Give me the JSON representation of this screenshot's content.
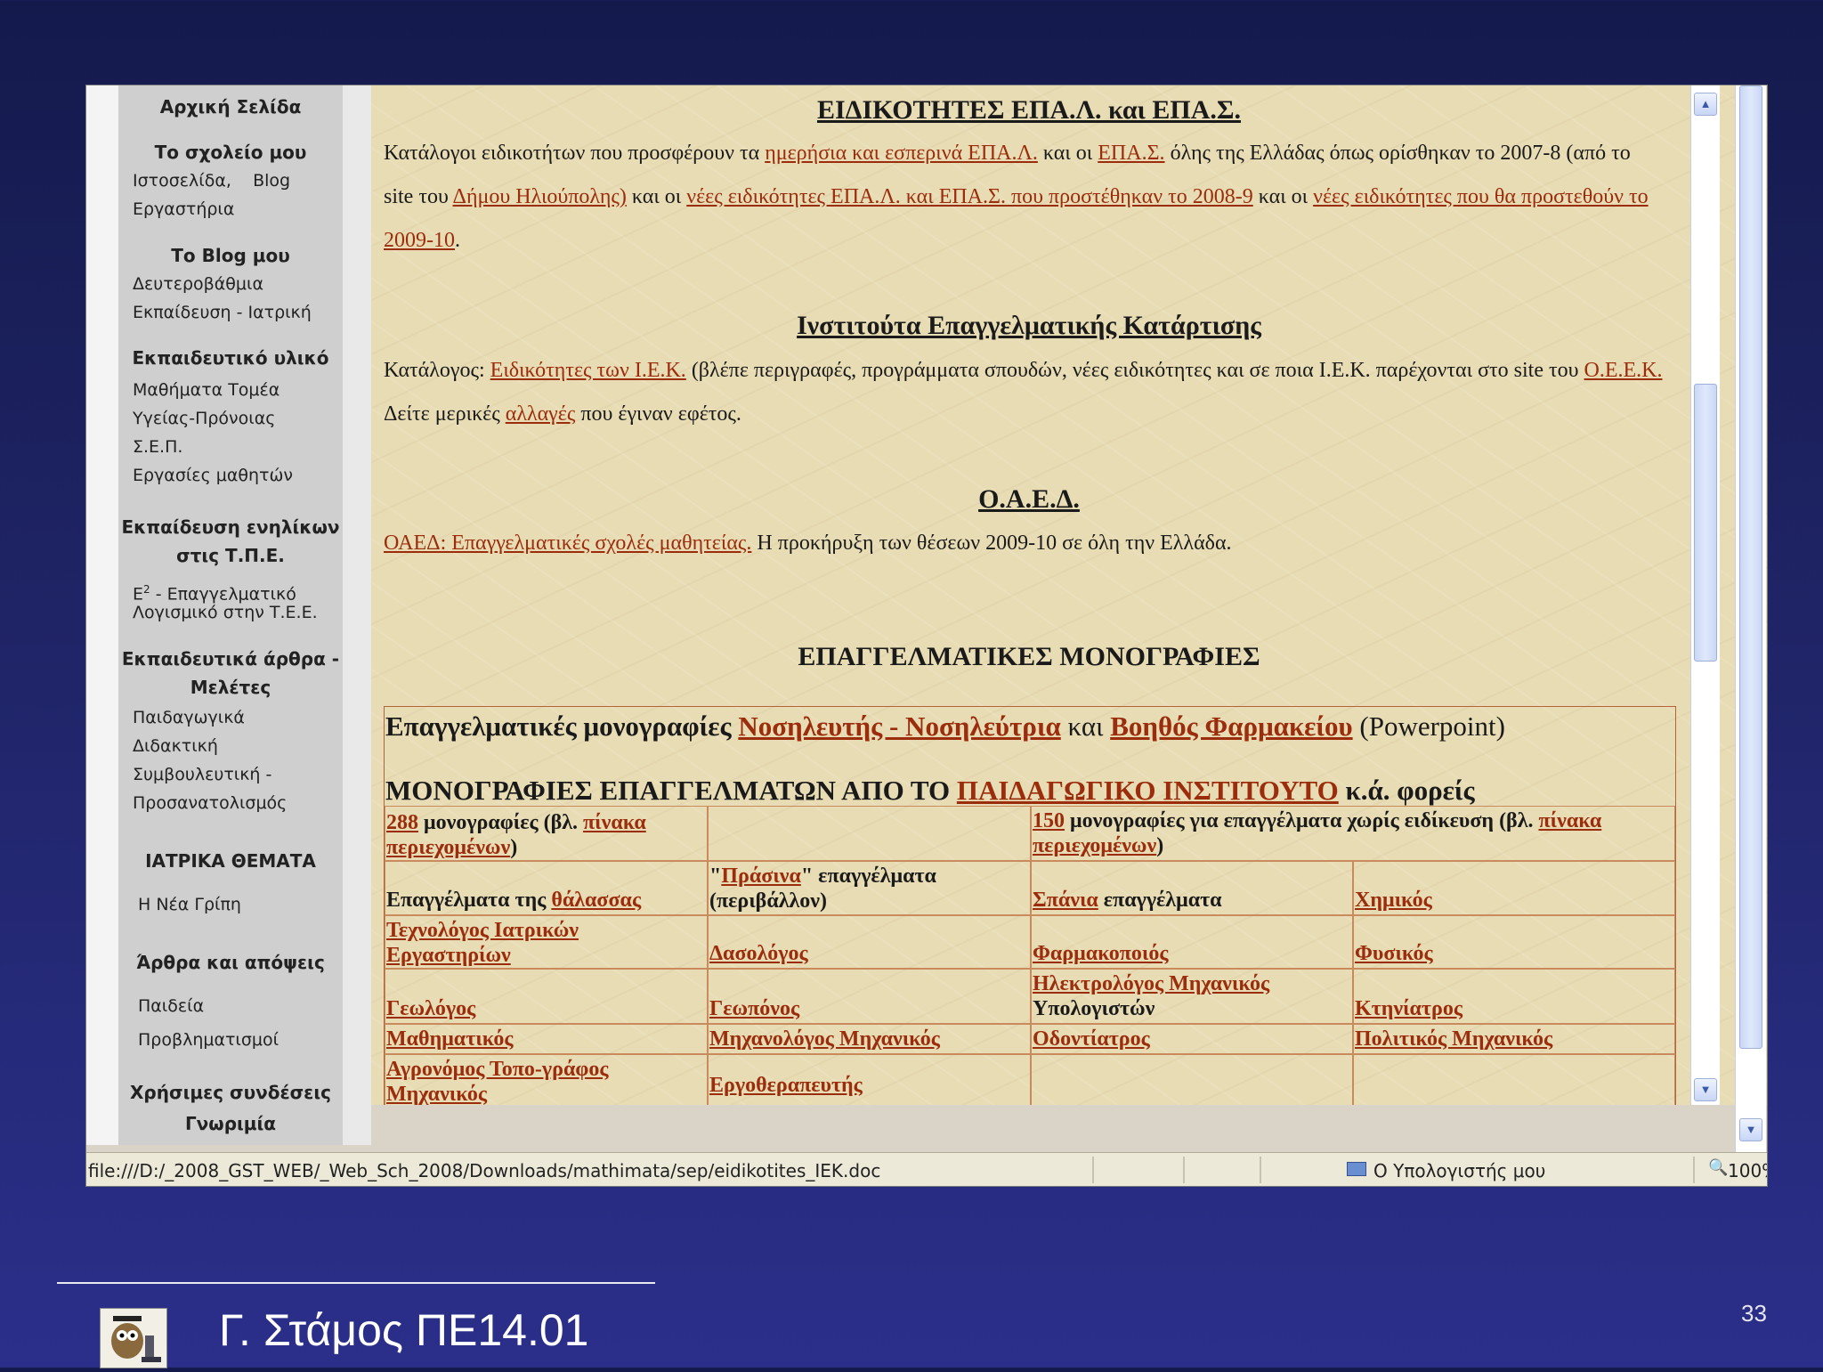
{
  "sidebar": {
    "home": "Αρχική  Σελίδα",
    "school_head": "Το σχολείο μου",
    "school_links": [
      "Ιστοσελίδα,",
      "Blog"
    ],
    "workshops": "Εργαστήρια",
    "blog_head": "Το Blog  μου",
    "blog_item1": "Δευτεροβάθμια",
    "blog_item2": "Εκπαίδευση - Ιατρική",
    "material_head": "Εκπαιδευτικό υλικό",
    "material_items": [
      "Μαθήματα Τομέα",
      "Υγείας-Πρόνοιας",
      "Σ.Ε.Π.",
      "Εργασίες μαθητών"
    ],
    "adult_head1": "Εκπαίδευση ενηλίκων",
    "adult_head2": "στις Τ.Π.Ε.",
    "adult_item1_pre": "Ε",
    "adult_item1_sup": "2",
    "adult_item1_post": " - Επαγγελματικό",
    "adult_item2": "Λογισμικό στην Τ.Ε.Ε.",
    "articles_head1": "Εκπαιδευτικά άρθρα -",
    "articles_head2": "Μελέτες",
    "articles_items": [
      "Παιδαγωγικά",
      "Διδακτική",
      "Συμβουλευτική -",
      "Προσανατολισμός"
    ],
    "medical_head": "ΙΑΤΡΙΚΑ ΘΕΜΑΤΑ",
    "medical_item": "Η Νέα Γρίπη",
    "opinions_head": "Άρθρα και απόψεις",
    "opinions_items": [
      "Παιδεία",
      "Προβληματισμοί"
    ],
    "useful_head": "Χρήσιμες συνδέσεις",
    "useful_item": "Γνωριμία"
  },
  "content": {
    "epal_title": "ΕΙΔΙΚΟΤΗΤΕΣ  ΕΠΑ.Λ. και ΕΠΑ.Σ.",
    "epal_p": {
      "t1": "Κατάλογοι ειδικοτήτων που προσφέρουν τα ",
      "l1": "ημερήσια και εσπερινά ΕΠΑ.Λ.",
      "t2": " και οι ",
      "l2": "ΕΠΑ.Σ.",
      "t3": " όλης της Ελλάδας όπως ορίσθηκαν το 2007-8 (από το site του ",
      "l3": "Δήμου Ηλιούπολης)",
      "t4": " και οι ",
      "l4": "νέες ειδικότητες ΕΠΑ.Λ. και ΕΠΑ.Σ. που προστέθηκαν το 2008-9",
      "t5": " και οι ",
      "l5": "νέες ειδικότητες που θα προστεθούν το 2009-10",
      "t6": "."
    },
    "iek_title": "Ινστιτούτα Επαγγελματικής Κατάρτισης",
    "iek_p": {
      "t1": "Κατάλογος: ",
      "l1": "Ειδικότητες των Ι.Ε.Κ.",
      "t2": " (βλέπε περιγραφές, προγράμματα σπουδών, νέες ειδικότητες και σε ποια Ι.Ε.Κ. παρέχονται στο site του ",
      "l2": "Ο.Ε.Ε.Κ.",
      "t3": " Δείτε μερικές ",
      "l3": "αλλαγές",
      "t4": " που έγιναν εφέτος."
    },
    "oaed_title": "Ο.Α.Ε.Δ.",
    "oaed_p": {
      "l1": "ΟΑΕΔ: Επαγγελματικές σχολές μαθητείας.",
      "t1": " Η προκήρυξη των θέσεων 2009-10 σε όλη την Ελλάδα."
    },
    "mono_title": "ΕΠΑΓΓΕΛΜΑΤΙΚΕΣ  ΜΟΝΟΓΡΑΦΙΕΣ",
    "mono_row1": {
      "t1": "Επαγγελματικές μονογραφίες ",
      "l1": "Νοσηλευτής - Νοσηλεύτρια",
      "t2": " και ",
      "l2": "Βοηθός Φαρμακείου",
      "t3": " (Powerpoint)"
    },
    "mono_row2": {
      "t1": "ΜΟΝΟΓΡΑΦΙΕΣ ΕΠΑΓΓΕΛΜΑΤΩΝ ΑΠΟ ΤΟ ",
      "l1": "ΠΑΙΔΑΓΩΓΙΚΟ ΙΝΣΤΙΤΟΥΤΟ",
      "t2": " κ.ά. φορείς"
    },
    "count_left": {
      "l1": "288",
      "t1": " μονογραφίες (βλ. ",
      "l2": "πίνακα περιεχομένων",
      "t2": ")"
    },
    "count_right": {
      "l1": "150",
      "t1": " μονογραφίες  για επαγγέλματα χωρίς ειδίκευση (βλ. ",
      "l2": "πίνακα περιεχομένων",
      "t2": ")"
    },
    "grid": {
      "r1c1_t": "Επαγγέλματα της ",
      "r1c1_l": "θάλασσας",
      "r1c2_q1": "\"",
      "r1c2_l": "Πράσινα",
      "r1c2_t": "\" επαγγέλματα (περιβάλλον)",
      "r1c3_l": "Σπάνια",
      "r1c3_t": " επαγγέλματα",
      "r1c4": "Χημικός",
      "r2c1": "Τεχνολόγος Ιατρικών Εργαστηρίων",
      "r2c2": "Δασολόγος",
      "r2c3": "Φαρμακοποιός",
      "r2c4": "Φυσικός",
      "r3c1": "Γεωλόγος",
      "r3c2": "Γεωπόνος",
      "r3c3_l": "Ηλεκτρολόγος Μηχανικός",
      "r3c3_t": "Υπολογιστών",
      "r3c4": "Κτηνίατρος",
      "r4c1": "Μαθηματικός",
      "r4c2": "Μηχανολόγος Μηχανικός",
      "r4c3": "Οδοντίατρος",
      "r4c4": "Πολιτικός Μηχανικός",
      "r5c1": "Αγρονόμος Τοπο-γράφος Μηχανικός",
      "r5c2": "Εργοθεραπευτής"
    }
  },
  "statusbar": {
    "url": "file:///D:/_2008_GST_WEB/_Web_Sch_2008/Downloads/mathimata/sep/eidikotites_IEK.doc",
    "zone": "Ο Υπολογιστής μου",
    "zoom": "100%"
  },
  "footer": {
    "author": "Γ. Στάμος ΠΕ14.01",
    "page": "33"
  },
  "colors": {
    "link": "#9b2c0c",
    "page_background": "#e8dcb4",
    "slide_background": "#1f2466"
  },
  "icons": [
    "scroll-up-icon",
    "scroll-down-icon",
    "computer-icon",
    "zoom-icon",
    "owl-logo-icon"
  ]
}
